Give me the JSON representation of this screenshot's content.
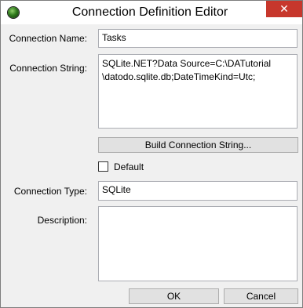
{
  "window": {
    "title": "Connection Definition Editor",
    "close_glyph": "✕",
    "app_icon": "green-globe-icon"
  },
  "form": {
    "connection_name": {
      "label": "Connection Name:",
      "value": "Tasks"
    },
    "connection_string": {
      "label": "Connection String:",
      "value_line1": "SQLite.NET?Data Source=C:\\DATutorial",
      "value_line2": "\\datodo.sqlite.db;DateTimeKind=Utc;"
    },
    "build_button_label": "Build Connection String...",
    "default_checkbox": {
      "label": "Default",
      "checked": false
    },
    "connection_type": {
      "label": "Connection Type:",
      "value": "SQLite"
    },
    "description": {
      "label": "Description:",
      "value": ""
    }
  },
  "buttons": {
    "ok": "OK",
    "cancel": "Cancel"
  },
  "colors": {
    "close_button": "#c7372c",
    "button_face": "#e1e1e1",
    "border": "#abadb3"
  }
}
